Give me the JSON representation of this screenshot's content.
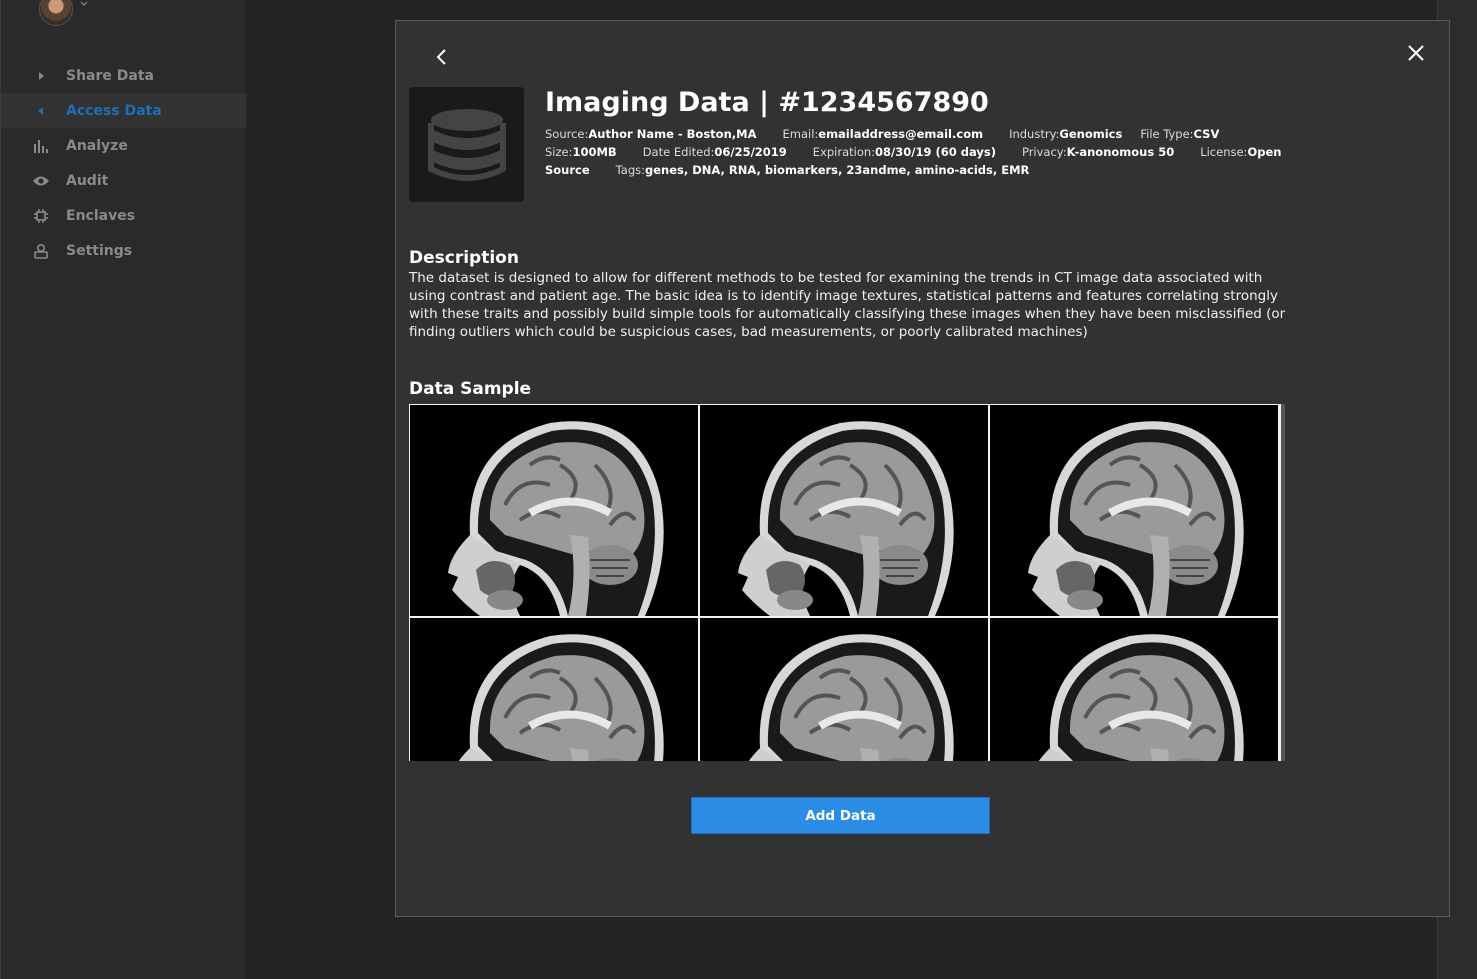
{
  "sidebar": {
    "items": [
      {
        "label": "Share Data",
        "icon": "caret-right-icon",
        "active": false
      },
      {
        "label": "Access Data",
        "icon": "caret-left-icon",
        "active": true
      },
      {
        "label": "Analyze",
        "icon": "bar-chart-icon",
        "active": false
      },
      {
        "label": "Audit",
        "icon": "eye-icon",
        "active": false
      },
      {
        "label": "Enclaves",
        "icon": "chip-icon",
        "active": false
      },
      {
        "label": "Settings",
        "icon": "user-lock-icon",
        "active": false
      }
    ]
  },
  "modal": {
    "title": "Imaging Data | #1234567890",
    "meta": {
      "source_label": "Source:",
      "source_value": "Author Name - Boston,MA",
      "email_label": "Email:",
      "email_value": "emailaddress@email.com",
      "industry_label": "Industry:",
      "industry_value": "Genomics",
      "filetype_label": "File Type:",
      "filetype_value": "CSV",
      "size_label": "Size:",
      "size_value": "100MB",
      "edited_label": "Date Edited:",
      "edited_value": "06/25/2019",
      "expiration_label": "Expiration:",
      "expiration_value": "08/30/19 (60 days)",
      "privacy_label": "Privacy:",
      "privacy_value": "K-anonomous 50",
      "license_label": "License:",
      "license_value": "Open",
      "license_value_cont": "Source",
      "tags_label": "Tags:",
      "tags_value": "genes, DNA, RNA, biomarkers, 23andme, amino-acids, EMR"
    },
    "description_title": "Description",
    "description_text": "The dataset is designed to allow for different methods to be tested for examining the trends in CT image data associated with using contrast and patient age. The basic idea is to identify image textures, statistical patterns and features correlating strongly with these traits and possibly build simple tools for automatically classifying these images when they have been misclassified (or finding outliers which could be suspicious cases, bad measurements, or poorly calibrated machines)",
    "sample_title": "Data Sample",
    "add_button": "Add Data"
  },
  "colors": {
    "accent": "#2b8ce6",
    "active_nav": "#1e6fb5",
    "background": "#232323",
    "modal": "#323232"
  }
}
